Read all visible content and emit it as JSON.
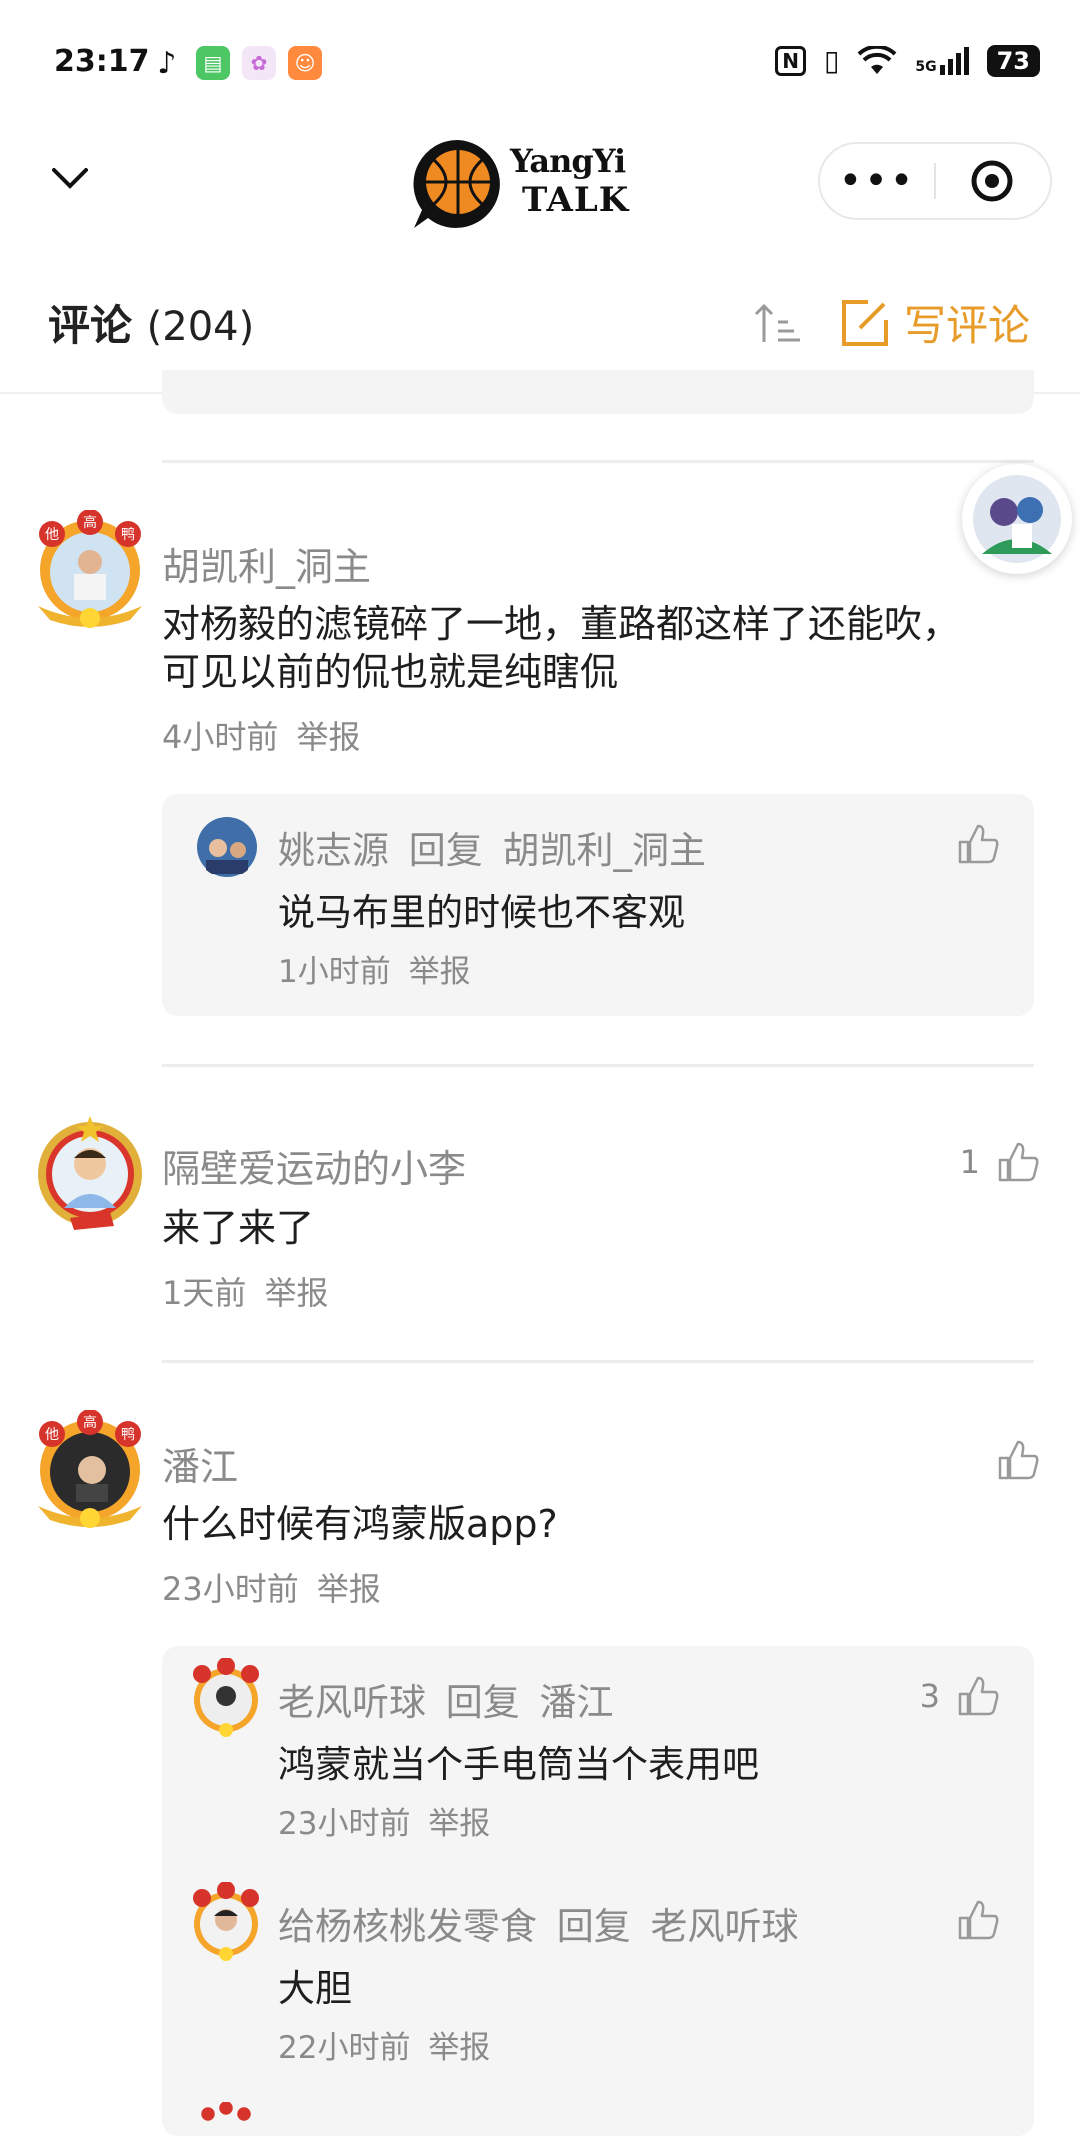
{
  "status": {
    "time": "23:17",
    "battery": "73",
    "network": "5G"
  },
  "header": {
    "logo_line1": "YangYi",
    "logo_line2": "TALK",
    "more_label": "•••"
  },
  "comment_bar": {
    "title": "评论",
    "count": "(204)",
    "write_label": "写评论"
  },
  "colors": {
    "accent": "#e79b28",
    "name_gray": "#8a8a8a",
    "reply_bg": "#f5f5f5"
  },
  "comments": [
    {
      "name": "胡凯利_洞主",
      "content_line1": "对杨毅的滤镜碎了一地，董路都这样了还能吹，",
      "content_line2": "可见以前的侃也就是纯瞎侃",
      "time": "4小时前",
      "report": "举报",
      "replies": [
        {
          "name": "姚志源",
          "reply_word": "回复",
          "target": "胡凯利_洞主",
          "content": "说马布里的时候也不客观",
          "time": "1小时前",
          "report": "举报"
        }
      ]
    },
    {
      "name": "隔壁爱运动的小李",
      "content_line1": "来了来了",
      "time": "1天前",
      "report": "举报",
      "likes": "1"
    },
    {
      "name": "潘江",
      "content_line1": "什么时候有鸿蒙版app?",
      "time": "23小时前",
      "report": "举报",
      "replies": [
        {
          "name": "老风听球",
          "reply_word": "回复",
          "target": "潘江",
          "content": "鸿蒙就当个手电筒当个表用吧",
          "time": "23小时前",
          "report": "举报",
          "likes": "3"
        },
        {
          "name": "给杨核桃发零食",
          "reply_word": "回复",
          "target": "老风听球",
          "content": "大胆",
          "time": "22小时前",
          "report": "举报"
        }
      ]
    }
  ],
  "badge_text": {
    "a": "他",
    "b": "高",
    "c": "鸭"
  }
}
